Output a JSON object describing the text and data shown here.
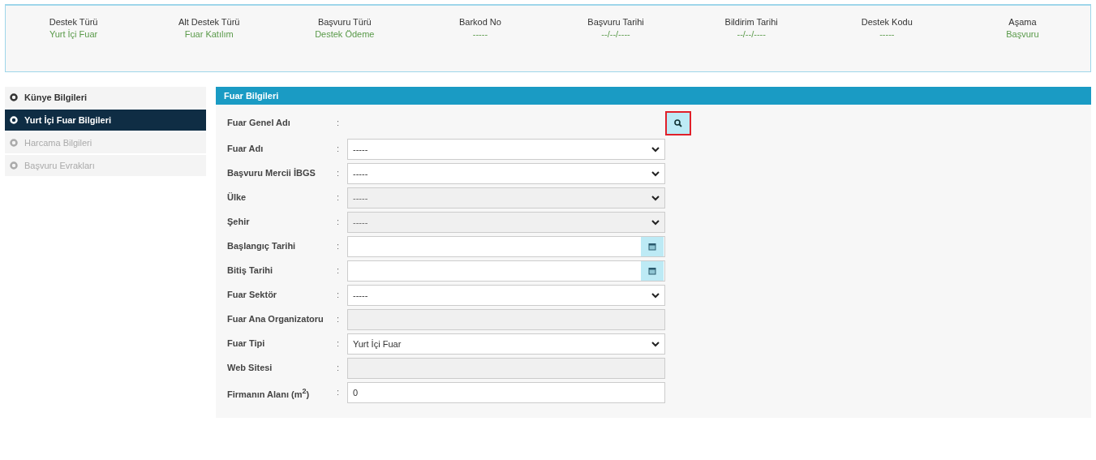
{
  "summary": [
    {
      "label": "Destek Türü",
      "value": "Yurt İçi Fuar"
    },
    {
      "label": "Alt Destek Türü",
      "value": "Fuar Katılım"
    },
    {
      "label": "Başvuru Türü",
      "value": "Destek Ödeme"
    },
    {
      "label": "Barkod No",
      "value": "-----"
    },
    {
      "label": "Başvuru Tarihi",
      "value": "--/--/----"
    },
    {
      "label": "Bildirim Tarihi",
      "value": "--/--/----"
    },
    {
      "label": "Destek Kodu",
      "value": "-----"
    },
    {
      "label": "Aşama",
      "value": "Başvuru"
    }
  ],
  "sidebar": {
    "items": [
      {
        "label": "Künye Bilgileri",
        "selected": false,
        "disabled": false
      },
      {
        "label": "Yurt İçi Fuar Bilgileri",
        "selected": true,
        "disabled": false
      },
      {
        "label": "Harcama Bilgileri",
        "selected": false,
        "disabled": true
      },
      {
        "label": "Başvuru Evrakları",
        "selected": false,
        "disabled": true
      }
    ]
  },
  "panel": {
    "title": "Fuar Bilgileri",
    "fields": [
      {
        "label": "Fuar Genel Adı",
        "colon": ":",
        "kind": "search",
        "highlighted": true
      },
      {
        "label": "Fuar Adı",
        "colon": ":",
        "kind": "select",
        "value": "-----",
        "disabled": false
      },
      {
        "label": "Başvuru Mercii İBGS",
        "colon": ":",
        "kind": "select",
        "value": "-----",
        "disabled": false
      },
      {
        "label": "Ülke",
        "colon": ":",
        "kind": "select",
        "value": "-----",
        "disabled": true
      },
      {
        "label": "Şehir",
        "colon": ":",
        "kind": "select",
        "value": "-----",
        "disabled": true
      },
      {
        "label": "Başlangıç Tarihi",
        "colon": ":",
        "kind": "date",
        "disabled": false
      },
      {
        "label": "Bitiş Tarihi",
        "colon": ":",
        "kind": "date",
        "disabled": false
      },
      {
        "label": "Fuar Sektör",
        "colon": ":",
        "kind": "select",
        "value": "-----",
        "disabled": false
      },
      {
        "label": "Fuar Ana Organizatoru",
        "colon": ":",
        "kind": "input",
        "disabled": true
      },
      {
        "label": "Fuar Tipi",
        "colon": ":",
        "kind": "select",
        "value": "Yurt İçi Fuar",
        "disabled": false
      },
      {
        "label": "Web Sitesi",
        "colon": ":",
        "kind": "input",
        "disabled": true
      },
      {
        "label": "Firmanın Alanı (m$^{2}$)",
        "colon": ":",
        "kind": "input",
        "value": "0",
        "disabled": false
      }
    ]
  }
}
